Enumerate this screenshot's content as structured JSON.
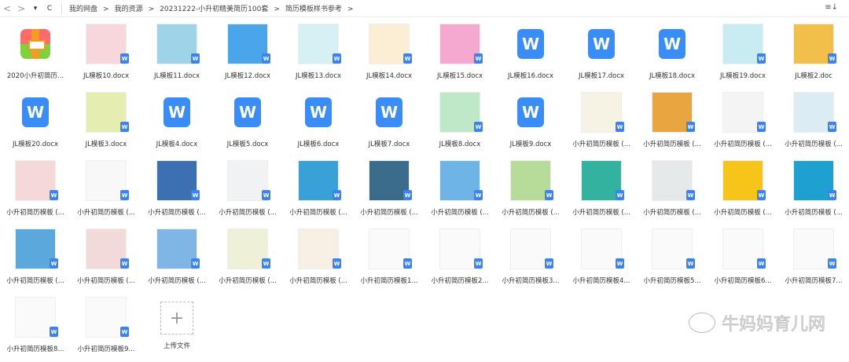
{
  "toolbar": {
    "back": "<",
    "forward": ">",
    "dropdown": "▾",
    "refresh": "C",
    "sort_icon": "≡↓"
  },
  "breadcrumb": [
    "我的网盘",
    "我的资源",
    "20231222-小升初精美简历100套",
    "简历模板样书参考"
  ],
  "files": [
    {
      "label": "2020小升初简历...",
      "type": "zip"
    },
    {
      "label": "JL模板10.docx",
      "type": "img",
      "color": "#f7d6dc"
    },
    {
      "label": "JL模板11.docx",
      "type": "img",
      "color": "#9fd3e8"
    },
    {
      "label": "JL模板12.docx",
      "type": "img",
      "color": "#4aa6e8"
    },
    {
      "label": "JL模板13.docx",
      "type": "img",
      "color": "#d6f0f4"
    },
    {
      "label": "JL模板14.docx",
      "type": "img",
      "color": "#fbeed4"
    },
    {
      "label": "JL模板15.docx",
      "type": "img",
      "color": "#f4a8d0"
    },
    {
      "label": "JL模板16.docx",
      "type": "word"
    },
    {
      "label": "JL模板17.docx",
      "type": "word"
    },
    {
      "label": "JL模板18.docx",
      "type": "word"
    },
    {
      "label": "JL模板19.docx",
      "type": "img",
      "color": "#c8ecf2"
    },
    {
      "label": "JL模板2.doc",
      "type": "img",
      "color": "#f2c04a"
    },
    {
      "label": "JL模板20.docx",
      "type": "word"
    },
    {
      "label": "JL模板3.docx",
      "type": "img",
      "color": "#e6edb0"
    },
    {
      "label": "JL模板4.docx",
      "type": "word"
    },
    {
      "label": "JL模板5.docx",
      "type": "word"
    },
    {
      "label": "JL模板6.docx",
      "type": "word"
    },
    {
      "label": "JL模板7.docx",
      "type": "word"
    },
    {
      "label": "JL模板8.docx",
      "type": "img",
      "color": "#bfe8c8"
    },
    {
      "label": "JL模板9.docx",
      "type": "word"
    },
    {
      "label": "小升初简历模板 (...",
      "type": "img",
      "color": "#f6f2e4"
    },
    {
      "label": "小升初简历模板 (...",
      "type": "img",
      "color": "#e9a640"
    },
    {
      "label": "小升初简历模板 (...",
      "type": "img",
      "color": "#f4f4f4"
    },
    {
      "label": "小升初简历模板 (...",
      "type": "img",
      "color": "#dcecf4"
    },
    {
      "label": "小升初简历模板 (...",
      "type": "img",
      "color": "#f5d8d8"
    },
    {
      "label": "小升初简历模板 (...",
      "type": "img",
      "color": "#f8f8f8"
    },
    {
      "label": "小升初简历模板 (...",
      "type": "img",
      "color": "#3d6fb3"
    },
    {
      "label": "小升初简历模板 (...",
      "type": "img",
      "color": "#f0f2f4"
    },
    {
      "label": "小升初简历模板 (...",
      "type": "img",
      "color": "#3aa0d8"
    },
    {
      "label": "小升初简历模板 (...",
      "type": "img",
      "color": "#3b6b8a"
    },
    {
      "label": "小升初简历模板 (...",
      "type": "img",
      "color": "#6fb4e6"
    },
    {
      "label": "小升初简历模板 (...",
      "type": "img",
      "color": "#b7dc9a"
    },
    {
      "label": "小升初简历模板 (...",
      "type": "img",
      "color": "#33b2a0"
    },
    {
      "label": "小升初简历模板 (...",
      "type": "img",
      "color": "#e4e8e8"
    },
    {
      "label": "小升初简历模板 (...",
      "type": "img",
      "color": "#f7c51a"
    },
    {
      "label": "小升初简历模板 (...",
      "type": "img",
      "color": "#1ea0d0"
    },
    {
      "label": "小升初简历模板 (...",
      "type": "img",
      "color": "#5aa8dc"
    },
    {
      "label": "小升初简历模板 (...",
      "type": "img",
      "color": "#f3dada"
    },
    {
      "label": "小升初简历模板 (...",
      "type": "img",
      "color": "#7fb6e6"
    },
    {
      "label": "小升初简历模板 (...",
      "type": "img",
      "color": "#eef0d8"
    },
    {
      "label": "小升初简历模板 (...",
      "type": "img",
      "color": "#f6efe4"
    },
    {
      "label": "小升初简历模板1...",
      "type": "img",
      "color": "#fafafa"
    },
    {
      "label": "小升初简历模板2...",
      "type": "img",
      "color": "#fafafa"
    },
    {
      "label": "小升初简历模板3...",
      "type": "img",
      "color": "#fafafa"
    },
    {
      "label": "小升初简历模板4...",
      "type": "img",
      "color": "#fafafa"
    },
    {
      "label": "小升初简历模板5...",
      "type": "img",
      "color": "#fafafa"
    },
    {
      "label": "小升初简历模板6...",
      "type": "img",
      "color": "#fafafa"
    },
    {
      "label": "小升初简历模板7...",
      "type": "img",
      "color": "#fafafa"
    },
    {
      "label": "小升初简历模板8...",
      "type": "img",
      "color": "#fafafa"
    },
    {
      "label": "小升初简历模板9...",
      "type": "img",
      "color": "#fafafa"
    },
    {
      "label": "上传文件",
      "type": "upload"
    }
  ],
  "watermark": "牛妈妈育儿网"
}
